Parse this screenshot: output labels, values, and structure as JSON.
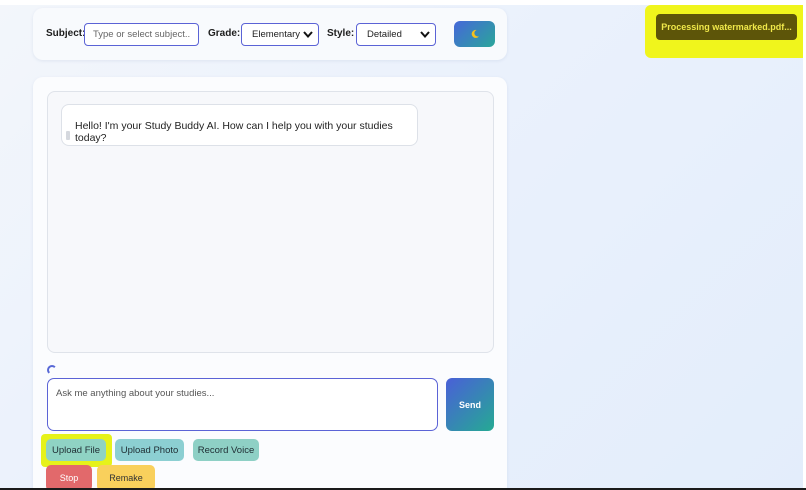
{
  "toolbar": {
    "subject_label": "Subject:",
    "subject_placeholder": "Type or select subject...",
    "grade_label": "Grade:",
    "grade_value": "Elementary",
    "style_label": "Style:",
    "style_value": "Detailed",
    "theme_icon": "moon-icon"
  },
  "chat": {
    "messages": [
      {
        "sender": "assistant",
        "text": "Hello! I'm your Study Buddy AI. How can I help you with your studies today?"
      }
    ]
  },
  "composer": {
    "placeholder": "Ask me anything about your studies...",
    "send_label": "Send"
  },
  "actions": {
    "upload_file": "Upload File",
    "upload_photo": "Upload Photo",
    "record_voice": "Record Voice",
    "stop": "Stop",
    "remake": "Remake"
  },
  "toast": {
    "text": "Processing watermarked.pdf..."
  },
  "colors": {
    "accent": "#5b63d6",
    "send_gradient_start": "#4a5fd8",
    "send_gradient_end": "#25aa93",
    "highlight": "#e6f21a",
    "stop": "#e2696b",
    "remake": "#f9d05c"
  }
}
